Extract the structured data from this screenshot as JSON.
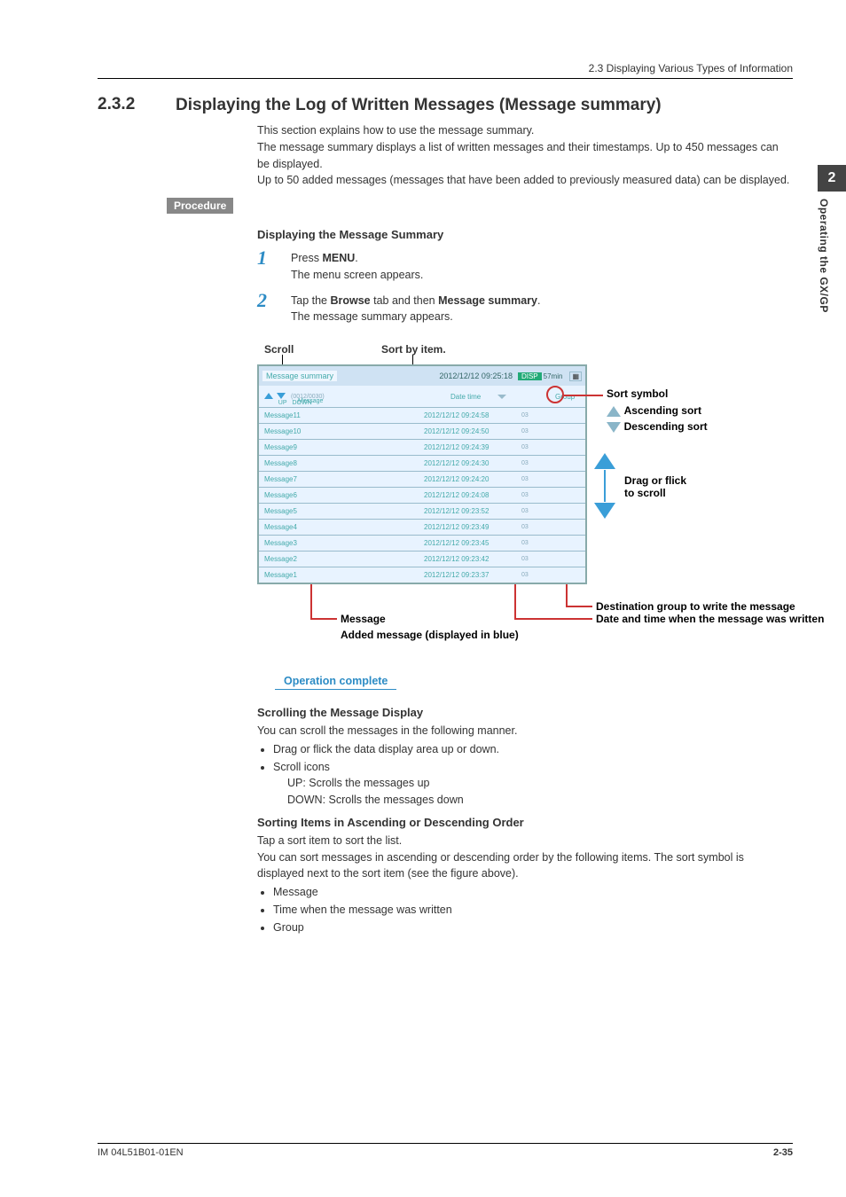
{
  "header": {
    "breadcrumb": "2.3  Displaying Various Types of Information"
  },
  "section": {
    "number": "2.3.2",
    "title": "Displaying the Log of Written Messages (Message summary)"
  },
  "intro": {
    "p1": "This section explains how to use the message summary.",
    "p2": "The message summary displays a list of written messages and their timestamps. Up to 450 messages can be displayed.",
    "p3": "Up to 50 added messages (messages that have been added to previously measured data) can be displayed."
  },
  "procedure_label": "Procedure",
  "subheads": {
    "disp": "Displaying the Message Summary",
    "scroll": "Scrolling the Message Display",
    "sort": "Sorting Items in Ascending or Descending Order"
  },
  "steps": {
    "s1": {
      "num": "1",
      "pre": "Press ",
      "bold": "MENU",
      "post": ".",
      "sub": "The menu screen appears."
    },
    "s2": {
      "num": "2",
      "pre": "Tap the ",
      "b1": "Browse",
      "mid": " tab and then ",
      "b2": "Message summary",
      "post": ".",
      "sub": "The message summary appears."
    }
  },
  "fig": {
    "labels": {
      "scroll": "Scroll",
      "sort_by": "Sort by item.",
      "sort_symbol": "Sort symbol",
      "asc": "Ascending sort",
      "desc": "Descending sort",
      "drag": "Drag or flick\nto scroll",
      "dest": "Destination group to write the message",
      "datetime": "Date and time when the message was written",
      "message": "Message",
      "added": "Added message (displayed in blue)"
    },
    "device": {
      "title": "Message summary",
      "datetime": "2012/12/12 09:25:18",
      "disp": "DISP",
      "disp_time": "57min",
      "counter": "(0012/0030)",
      "up": "UP",
      "down": "DOWN",
      "col_message": "Message",
      "col_datetime": "Date time",
      "col_group": "Group",
      "rows": [
        {
          "msg": "Message11",
          "dt": "2012/12/12 09:24:58",
          "g": "03"
        },
        {
          "msg": "Message10",
          "dt": "2012/12/12 09:24:50",
          "g": "03"
        },
        {
          "msg": "Message9",
          "dt": "2012/12/12 09:24:39",
          "g": "03"
        },
        {
          "msg": "Message8",
          "dt": "2012/12/12 09:24:30",
          "g": "03"
        },
        {
          "msg": "Message7",
          "dt": "2012/12/12 09:24:20",
          "g": "03"
        },
        {
          "msg": "Message6",
          "dt": "2012/12/12 09:24:08",
          "g": "03"
        },
        {
          "msg": "Message5",
          "dt": "2012/12/12 09:23:52",
          "g": "03"
        },
        {
          "msg": "Message4",
          "dt": "2012/12/12 09:23:49",
          "g": "03"
        },
        {
          "msg": "Message3",
          "dt": "2012/12/12 09:23:45",
          "g": "03"
        },
        {
          "msg": "Message2",
          "dt": "2012/12/12 09:23:42",
          "g": "03"
        },
        {
          "msg": "Message1",
          "dt": "2012/12/12 09:23:37",
          "g": "03"
        }
      ]
    }
  },
  "op_complete": "Operation complete",
  "scrolling": {
    "intro": "You can scroll the messages in the following manner.",
    "b1": "Drag or flick the data display area up or down.",
    "b2": "Scroll icons",
    "b2a": "UP: Scrolls the messages up",
    "b2b": "DOWN: Scrolls the messages down"
  },
  "sorting": {
    "p1": "Tap a sort item to sort the list.",
    "p2": "You can sort messages in ascending or descending order by the following items. The sort symbol is displayed next to the sort item (see the figure above).",
    "b1": "Message",
    "b2": "Time when the message was written",
    "b3": "Group"
  },
  "sidebar": {
    "chapter": "2",
    "text": "Operating the GX/GP"
  },
  "footer": {
    "left": "IM 04L51B01-01EN",
    "right": "2-35"
  }
}
